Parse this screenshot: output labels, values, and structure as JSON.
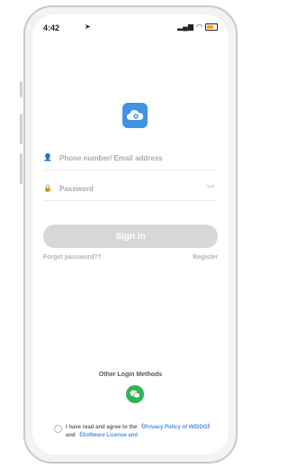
{
  "status": {
    "time": "4:42"
  },
  "login": {
    "account_placeholder": "Phone number/ Email address",
    "password_placeholder": "Password",
    "signin_label": "Sign in",
    "forgot_label": "Forget password??",
    "register_label": "Register",
    "other_methods_label": "Other Login Methods"
  },
  "agreement": {
    "prefix": "I have read and agree to the",
    "privacy": "《Privacy Policy of WIDDO》",
    "and": "and",
    "license": "《Software License and"
  },
  "colors": {
    "brand": "#3f92e6",
    "wechat": "#2fb457",
    "link_blue": "#4e8fe3"
  }
}
